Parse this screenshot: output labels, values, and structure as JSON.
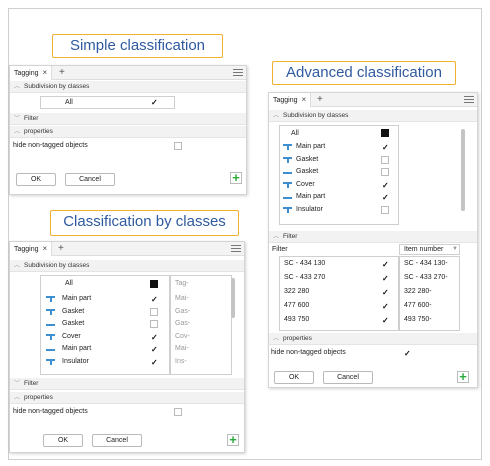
{
  "callouts": {
    "simple": "Simple classification",
    "advanced": "Advanced classification",
    "by_classes": "Classification by classes"
  },
  "common": {
    "tab_label": "Tagging",
    "close_glyph": "×",
    "add_tab_glyph": "+",
    "subdivision": "Subdivision by classes",
    "filter": "Filter",
    "properties": "properties",
    "hide_untagged": "hide non-tagged objects",
    "ok": "OK",
    "cancel": "Cancel",
    "add_glyph": "+",
    "all": "All",
    "check_glyph": "✓",
    "section_open_icon": "chevron-up-icon",
    "section_closed_icon": "chevron-down-icon"
  },
  "simple_panel": {
    "all_checked": true,
    "filter_collapsed": true,
    "properties_expanded": true,
    "hide_untagged_checked": false
  },
  "advanced_panel": {
    "classes": [
      {
        "name": "Main part",
        "icon": "beam-icon",
        "checked": true
      },
      {
        "name": "Gasket",
        "icon": "beam-icon",
        "checked": false
      },
      {
        "name": "Gasket",
        "icon": "plate-icon",
        "checked": false
      },
      {
        "name": "Cover",
        "icon": "beam-icon",
        "checked": true
      },
      {
        "name": "Main part",
        "icon": "plate-icon",
        "checked": true
      },
      {
        "name": "Insulator",
        "icon": "beam-icon",
        "checked": false
      }
    ],
    "filter_header": "Filter",
    "item_number_header": "Item number",
    "filter_rows": [
      {
        "value": "SC - 434 130",
        "checked": true,
        "item": "SC - 434 130-"
      },
      {
        "value": "SC - 433 270",
        "checked": true,
        "item": "SC - 433 270-"
      },
      {
        "value": "322 280",
        "checked": true,
        "item": "322 280-"
      },
      {
        "value": "477 600",
        "checked": true,
        "item": "477 600-"
      },
      {
        "value": "493 750",
        "checked": true,
        "item": "493 750-"
      }
    ],
    "hide_untagged_checked": true
  },
  "classes_panel": {
    "tag_header": "Tag-",
    "classes": [
      {
        "name": "Main part",
        "icon": "beam-icon",
        "checked": true,
        "tag": "Mai-"
      },
      {
        "name": "Gasket",
        "icon": "beam-icon",
        "checked": false,
        "tag": "Gas-"
      },
      {
        "name": "Gasket",
        "icon": "plate-icon",
        "checked": false,
        "tag": "Gas-"
      },
      {
        "name": "Cover",
        "icon": "beam-icon",
        "checked": true,
        "tag": "Cov-"
      },
      {
        "name": "Main part",
        "icon": "plate-icon",
        "checked": true,
        "tag": "Mai-"
      },
      {
        "name": "Insulator",
        "icon": "beam-icon",
        "checked": true,
        "tag": "Ins-"
      }
    ],
    "hide_untagged_checked": false
  },
  "colors": {
    "callout_border": "#f2b030",
    "callout_text": "#2f5aa0",
    "icon_blue": "#3d8fd1",
    "add_green": "#2eaa3c"
  }
}
